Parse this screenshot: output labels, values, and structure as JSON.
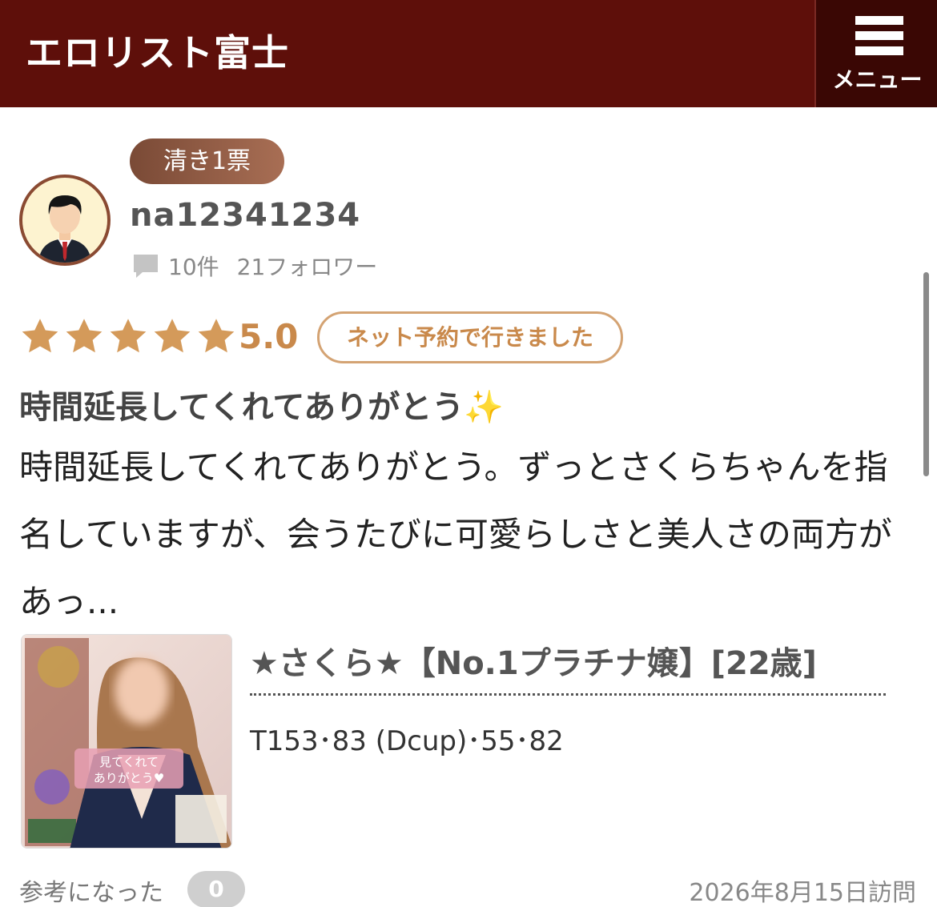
{
  "header": {
    "site_title": "エロリスト富士",
    "menu_label": "メニュー"
  },
  "review": {
    "badge": "清き1票",
    "username": "na12341234",
    "review_count": "10件",
    "followers": "21フォロワー",
    "rating": 5,
    "rating_display": "5.0",
    "booking_tag": "ネット予約で行きました",
    "title": "時間延長してくれてありがとう✨",
    "body": "時間延長してくれてありがとう。ずっとさくらちゃんを指名していますが、会うたびに可愛らしさと美人さの両方があっ..."
  },
  "girl": {
    "name": "★さくら★【No.1プラチナ嬢】[22歳]",
    "stats": "T153･83 (Dcup)･55･82",
    "photo_caption": "見てくれてありがとう"
  },
  "footer": {
    "helpful_label": "参考になった",
    "helpful_count": "0",
    "visit_date": "2026年8月15日訪問"
  },
  "colors": {
    "header_bg": "#5e0f0a",
    "accent_gold": "#c9894b",
    "badge_brown": "#8a5a40"
  }
}
